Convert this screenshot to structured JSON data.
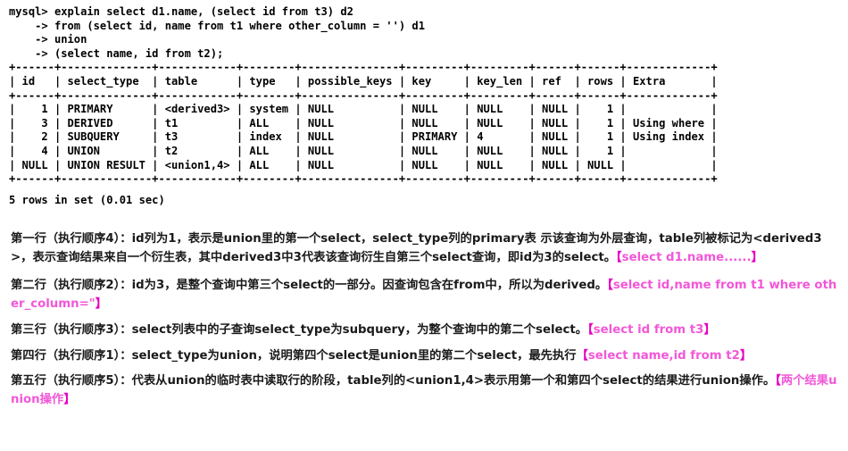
{
  "terminal": {
    "prompt_lines": [
      "mysql> explain select d1.name, (select id from t3) d2",
      "    -> from (select id, name from t1 where other_column = '') d1",
      "    -> union",
      "    -> (select name, id from t2);"
    ],
    "rule_top": "+------+--------------+------------+--------+---------------+---------+---------+------+------+-------------+",
    "header_row": "| id   | select_type  | table      | type   | possible_keys | key     | key_len | ref  | rows | Extra       |",
    "rule_mid": "+------+--------------+------------+--------+---------------+---------+---------+------+------+-------------+",
    "data_rows": [
      "|    1 | PRIMARY      | <derived3> | system | NULL          | NULL    | NULL    | NULL |    1 |             |",
      "|    3 | DERIVED      | t1         | ALL    | NULL          | NULL    | NULL    | NULL |    1 | Using where |",
      "|    2 | SUBQUERY     | t3         | index  | NULL          | PRIMARY | 4       | NULL |    1 | Using index |",
      "|    4 | UNION        | t2         | ALL    | NULL          | NULL    | NULL    | NULL |    1 |             |",
      "| NULL | UNION RESULT | <union1,4> | ALL    | NULL          | NULL    | NULL    | NULL | NULL |             |"
    ],
    "rule_bottom": "+------+--------------+------------+--------+---------------+---------+---------+------+------+-------------+",
    "result_footer": "5 rows in set (0.01 sec)",
    "columns": [
      "id",
      "select_type",
      "table",
      "type",
      "possible_keys",
      "key",
      "key_len",
      "ref",
      "rows",
      "Extra"
    ],
    "rows": [
      {
        "id": "1",
        "select_type": "PRIMARY",
        "table": "<derived3>",
        "type": "system",
        "possible_keys": "NULL",
        "key": "NULL",
        "key_len": "NULL",
        "ref": "NULL",
        "rows": "1",
        "extra": ""
      },
      {
        "id": "3",
        "select_type": "DERIVED",
        "table": "t1",
        "type": "ALL",
        "possible_keys": "NULL",
        "key": "NULL",
        "key_len": "NULL",
        "ref": "NULL",
        "rows": "1",
        "extra": "Using where"
      },
      {
        "id": "2",
        "select_type": "SUBQUERY",
        "table": "t3",
        "type": "index",
        "possible_keys": "NULL",
        "key": "PRIMARY",
        "key_len": "4",
        "ref": "NULL",
        "rows": "1",
        "extra": "Using index"
      },
      {
        "id": "4",
        "select_type": "UNION",
        "table": "t2",
        "type": "ALL",
        "possible_keys": "NULL",
        "key": "NULL",
        "key_len": "NULL",
        "ref": "NULL",
        "rows": "1",
        "extra": ""
      },
      {
        "id": "NULL",
        "select_type": "UNION RESULT",
        "table": "<union1,4>",
        "type": "ALL",
        "possible_keys": "NULL",
        "key": "NULL",
        "key_len": "NULL",
        "ref": "NULL",
        "rows": "NULL",
        "extra": ""
      }
    ]
  },
  "prose": {
    "p1": {
      "text": "第一行（执行顺序4）：id列为1，表示是union里的第一个select，select_type列的primary表 示该查询为外层查询，table列被标记为<derived3>，表示查询结果来自一个衍生表，其中derived3中3代表该查询衍生自第三个select查询，即id为3的select。",
      "bracket_open": "【",
      "highlight": "select d1.name......",
      "bracket_close": "】"
    },
    "p2": {
      "text": "第二行（执行顺序2）：id为3，是整个查询中第三个select的一部分。因查询包含在from中，所以为derived。",
      "bracket_open": "【",
      "highlight": "select id,name from t1 where other_column=\"",
      "bracket_close": "】"
    },
    "p3": {
      "text": "第三行（执行顺序3）：select列表中的子查询select_type为subquery，为整个查询中的第二个select。",
      "bracket_open": "【",
      "highlight": "select id from t3",
      "bracket_close": "】"
    },
    "p4": {
      "text": "第四行（执行顺序1）：select_type为union，说明第四个select是union里的第二个select，最先执行",
      "bracket_open": "【",
      "highlight": "select name,id from t2",
      "bracket_close": "】"
    },
    "p5": {
      "text_before": "第五行（执行顺序5）：代表从union的临时表中读取行的阶段，table列的<union1,4>表示用第一个和第四个select的结果进行union操作。",
      "bracket_open": "【",
      "highlight": "两个结果union操作",
      "bracket_close": "】"
    }
  },
  "colors": {
    "highlight_pink": "#f257d8",
    "bracket_magenta": "#e600c3",
    "text_black": "#1a1a1a",
    "terminal_fg": "#000000",
    "background": "#ffffff"
  }
}
